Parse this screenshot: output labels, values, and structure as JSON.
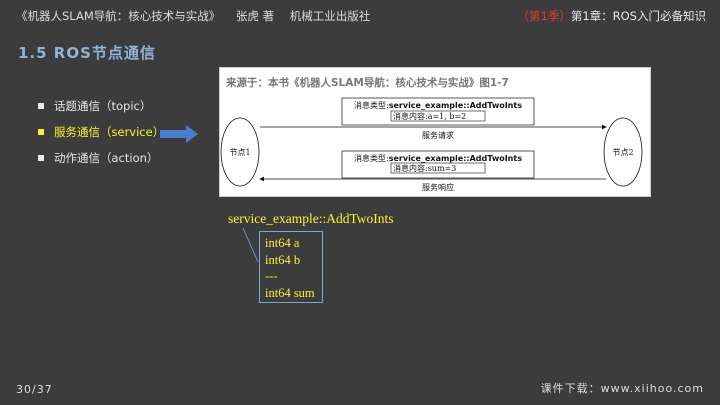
{
  "header": {
    "book_title": "《机器人SLAM导航：核心技术与实战》",
    "author": "张虎 著",
    "publisher": "机械工业出版社",
    "season": "（第1季）",
    "chapter": "第1章：ROS入门必备知识"
  },
  "section": {
    "title": "1.5 ROS节点通信"
  },
  "bullets": [
    {
      "label": "话题通信（topic）"
    },
    {
      "label": "服务通信（service）"
    },
    {
      "label": "动作通信（action）"
    }
  ],
  "figure": {
    "caption": "来源于：本书《机器人SLAM导航：核心技术与实战》图1-7",
    "node1": "节点1",
    "node2": "节点2",
    "request_type_prefix": "消息类型:",
    "request_type": "service_example::AddTwoInts",
    "request_content": "消息内容:a=1, b=2",
    "request_label": "服务请求",
    "response_type_prefix": "消息类型:",
    "response_type": "service_example::AddTwoInts",
    "response_content": "消息内容:sum=3",
    "response_label": "服务响应"
  },
  "service_def": {
    "title": "service_example::AddTwoInts",
    "lines": [
      "int64 a",
      "int64 b",
      "---",
      "int64 sum"
    ]
  },
  "footer": {
    "page": "30/37",
    "download": "课件下载：www.xiihoo.com"
  },
  "colors": {
    "background": "#3c3c3c",
    "highlight": "#ffef3a",
    "section_title": "#8fb4dc",
    "season_red": "#e03c28",
    "arrow_blue": "#4a7fd0"
  }
}
